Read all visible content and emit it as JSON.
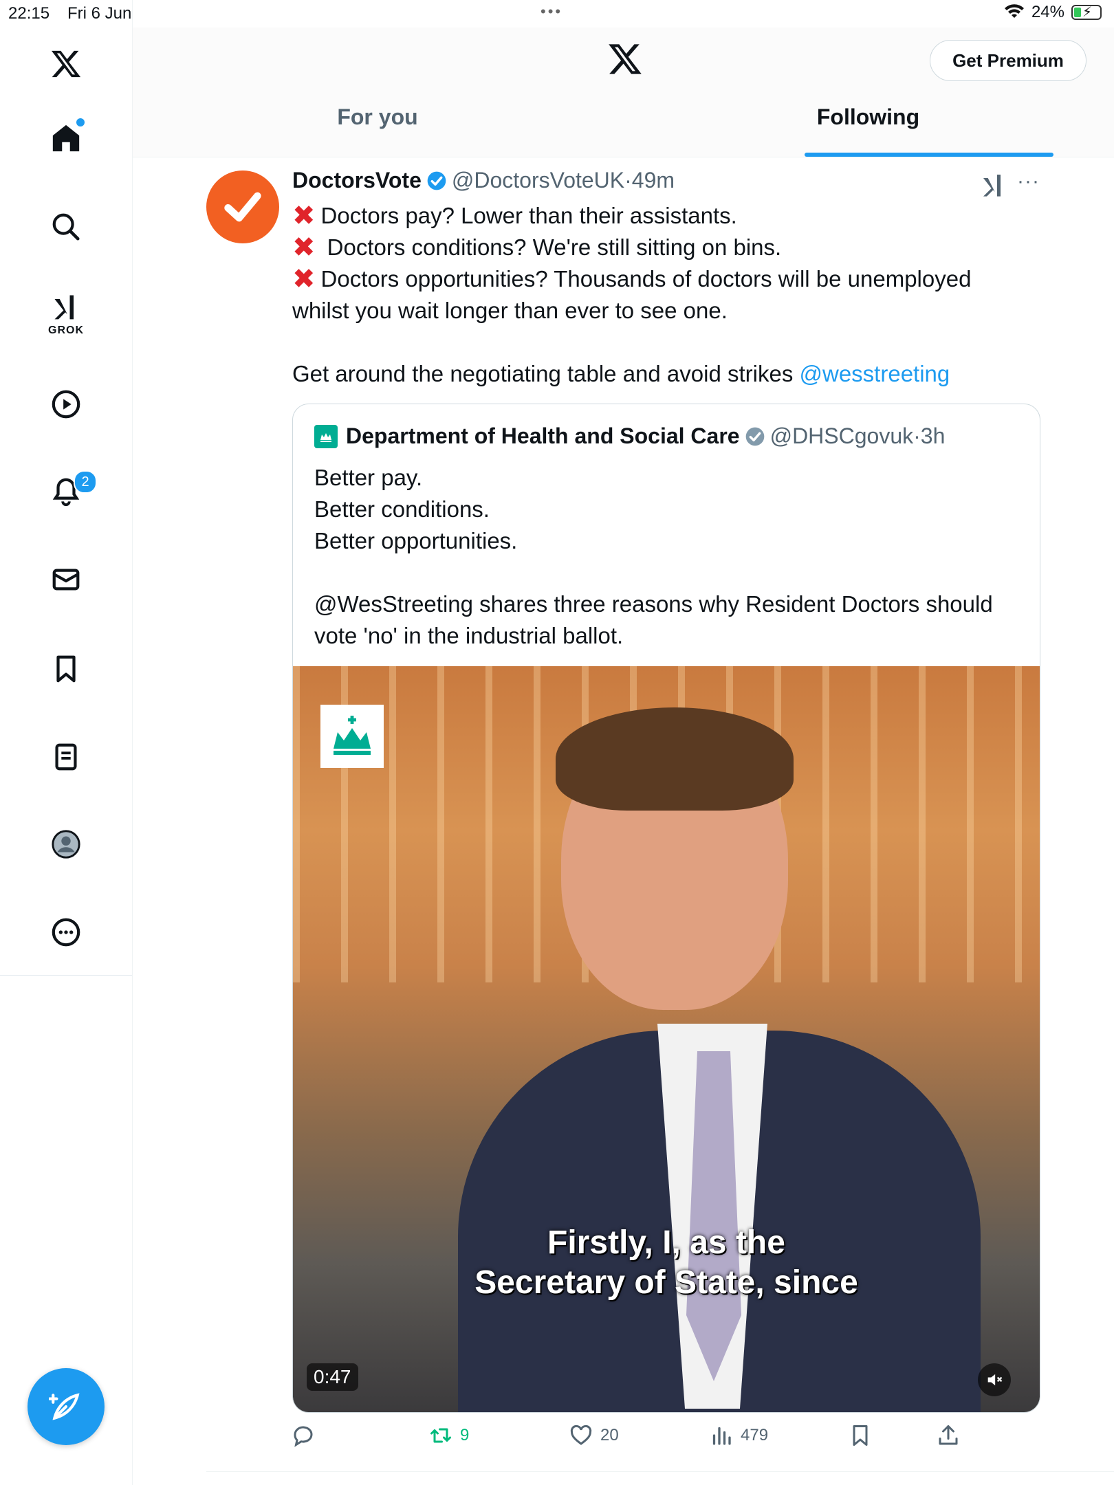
{
  "status_bar": {
    "time": "22:15",
    "date": "Fri 6 Jun",
    "battery": "24%"
  },
  "sidebar": {
    "items": [
      {
        "id": "home",
        "icon": "home-icon",
        "has_dot": true
      },
      {
        "id": "search",
        "icon": "search-icon"
      },
      {
        "id": "grok",
        "icon": "grok-icon",
        "label": "GROK"
      },
      {
        "id": "video",
        "icon": "play-icon"
      },
      {
        "id": "notifications",
        "icon": "bell-icon",
        "badge": "2"
      },
      {
        "id": "messages",
        "icon": "mail-icon"
      },
      {
        "id": "bookmarks",
        "icon": "bookmark-icon"
      },
      {
        "id": "lists",
        "icon": "list-icon"
      },
      {
        "id": "profile",
        "icon": "profile-icon"
      },
      {
        "id": "more",
        "icon": "more-icon"
      }
    ],
    "compose": "compose-icon"
  },
  "header": {
    "get_premium": "Get Premium",
    "tabs": [
      {
        "label": "For you",
        "active": false
      },
      {
        "label": "Following",
        "active": true
      }
    ]
  },
  "tweet": {
    "name": "DoctorsVote",
    "handle": "@DoctorsVoteUK",
    "time": "49m",
    "lines": [
      "Doctors pay? Lower than their assistants.",
      " Doctors conditions? We're still sitting on bins.",
      "Doctors opportunities? Thousands of doctors will be unemployed",
      "whilst you wait longer than ever to see one."
    ],
    "closing": "Get around the negotiating table and avoid strikes",
    "mention": "@wesstreeting",
    "quote": {
      "name": "Department of Health and Social Care",
      "handle": "@DHSCgovuk",
      "time": "3h",
      "lines": [
        "Better pay.",
        "Better conditions.",
        "Better opportunities."
      ],
      "body": "@WesStreeting shares three reasons why Resident Doctors should vote 'no' in the industrial ballot.",
      "video": {
        "subtitle_line1": "Firstly, I, as the",
        "subtitle_line2": "Secretary of State, since",
        "duration": "0:47"
      }
    },
    "stats": {
      "replies": "",
      "reposts": "9",
      "likes": "20",
      "views": "479"
    }
  },
  "colors": {
    "accent": "#1d9bf0",
    "repost": "#00ba7c",
    "avatar": "#f26022",
    "x_mark": "#e0242b"
  }
}
